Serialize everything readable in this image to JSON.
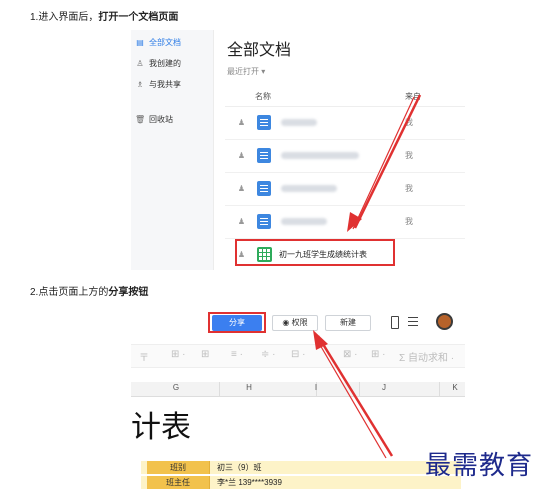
{
  "steps": [
    {
      "prefix": "1.进入界面后，",
      "bold": "打开一个文档页面"
    },
    {
      "prefix": "2.点击页面上方的",
      "bold": "分享按钮"
    }
  ],
  "screen1": {
    "sidebar": [
      {
        "icon": "doc-icon",
        "label": "全部文档",
        "active": true
      },
      {
        "icon": "person-icon",
        "label": "我创建的"
      },
      {
        "icon": "people-icon",
        "label": "与我共享"
      },
      {
        "icon": "trash-icon",
        "label": "回收站"
      }
    ],
    "title": "全部文档",
    "recent_filter": "最近打开 ▾",
    "columns": {
      "name": "名称",
      "owner": "来自"
    },
    "rows": [
      {
        "owner": "我"
      },
      {
        "owner": "我"
      },
      {
        "owner": "我"
      },
      {
        "owner": "我"
      }
    ],
    "highlighted_file": "初一九班学生成绩统计表"
  },
  "screen2": {
    "share_label": "分享",
    "permission_label": "◉ 权限",
    "new_label": "新建",
    "autosum_label": "Σ 自动求和 ·",
    "columns": [
      "G",
      "H",
      "I",
      "J",
      "K"
    ],
    "sheet_title": "计表",
    "cells": [
      {
        "label": "班别",
        "value": "初三（9）班"
      },
      {
        "label": "班主任",
        "value": "李*兰 139****3939"
      }
    ]
  },
  "colors": {
    "accent": "#3b7ff0",
    "highlight": "#e03131",
    "sheet_green": "#2eab5b",
    "doc_blue": "#3d87e0"
  },
  "watermark": "最需教育"
}
